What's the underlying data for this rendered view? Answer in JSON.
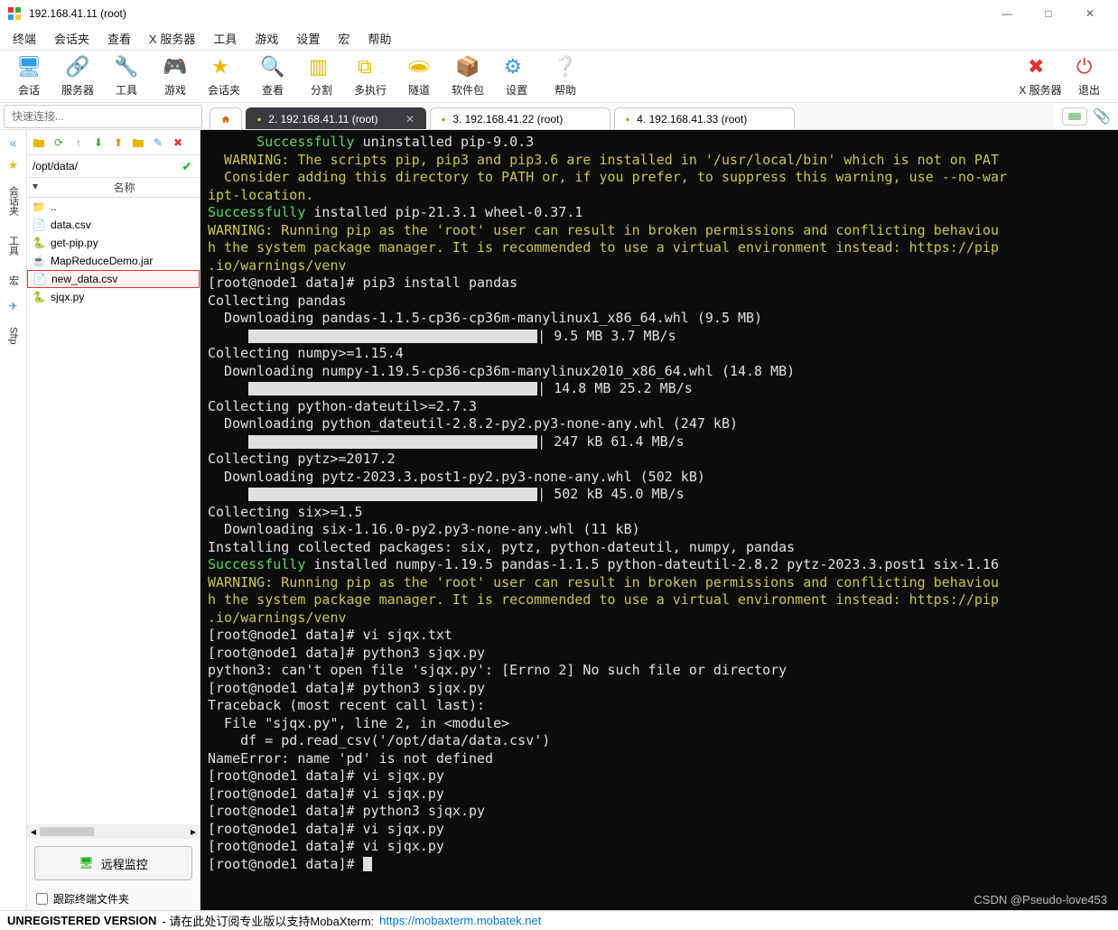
{
  "window": {
    "title": "192.168.41.11 (root)"
  },
  "menu": [
    "终端",
    "会话夹",
    "查看",
    "X 服务器",
    "工具",
    "游戏",
    "设置",
    "宏",
    "帮助"
  ],
  "toolbar": [
    {
      "label": "会话",
      "name": "session"
    },
    {
      "label": "服务器",
      "name": "server"
    },
    {
      "label": "工具",
      "name": "tools"
    },
    {
      "label": "游戏",
      "name": "games"
    },
    {
      "label": "会话夹",
      "name": "session-folder"
    },
    {
      "label": "查看",
      "name": "view"
    },
    {
      "label": "分割",
      "name": "split"
    },
    {
      "label": "多执行",
      "name": "multiexec"
    },
    {
      "label": "隧道",
      "name": "tunnel"
    },
    {
      "label": "软件包",
      "name": "packages"
    },
    {
      "label": "设置",
      "name": "settings"
    },
    {
      "label": "帮助",
      "name": "help"
    }
  ],
  "toolbar_right": [
    {
      "label": "X 服务器",
      "name": "xserver"
    },
    {
      "label": "退出",
      "name": "exit"
    }
  ],
  "quick": {
    "placeholder": "快速连接..."
  },
  "tabs": [
    {
      "label": "2. 192.168.41.11 (root)",
      "active": true
    },
    {
      "label": "3. 192.168.41.22 (root)",
      "active": false
    },
    {
      "label": "4. 192.168.41.33 (root)",
      "active": false
    }
  ],
  "sidebar_tabs": [
    "会话夹",
    "工具",
    "宏",
    "Sftp"
  ],
  "sftp": {
    "path": "/opt/data/",
    "header_name": "名称",
    "items": [
      {
        "name": "..",
        "type": "up"
      },
      {
        "name": "data.csv",
        "type": "csv"
      },
      {
        "name": "get-pip.py",
        "type": "py"
      },
      {
        "name": "MapReduceDemo.jar",
        "type": "jar"
      },
      {
        "name": "new_data.csv",
        "type": "csv",
        "selected": true
      },
      {
        "name": "sjqx.py",
        "type": "py"
      }
    ],
    "remote_monitor": "远程监控",
    "follow_checkbox": "跟踪终端文件夹"
  },
  "terminal": {
    "lines": [
      {
        "segs": [
          {
            "c": "grn",
            "t": "      Successfully"
          },
          {
            "t": " uninstalled pip-9.0.3"
          }
        ]
      },
      {
        "segs": [
          {
            "c": "yel",
            "t": "  WARNING: The scripts pip, pip3 and pip3.6 are installed in '/usr/local/bin' which is not on PAT"
          }
        ]
      },
      {
        "segs": [
          {
            "c": "yel",
            "t": "  Consider adding this directory to PATH or, if you prefer, to suppress this warning, use --no-war"
          }
        ]
      },
      {
        "segs": [
          {
            "c": "yel",
            "t": "ipt-location."
          }
        ]
      },
      {
        "segs": [
          {
            "c": "grn",
            "t": "Successfully"
          },
          {
            "t": " installed pip-21.3.1 wheel-0.37.1"
          }
        ]
      },
      {
        "segs": [
          {
            "c": "yel",
            "t": "WARNING: Running pip as the 'root' user can result in broken permissions and conflicting behaviou"
          }
        ]
      },
      {
        "segs": [
          {
            "c": "yel",
            "t": "h the system package manager. It is recommended to use a virtual environment instead: https://pip"
          }
        ]
      },
      {
        "segs": [
          {
            "c": "yel",
            "t": ".io/warnings/venv"
          }
        ]
      },
      {
        "segs": [
          {
            "t": "[root@node1 data]# pip3 install pandas"
          }
        ]
      },
      {
        "segs": [
          {
            "t": "Collecting pandas"
          }
        ]
      },
      {
        "segs": [
          {
            "t": "  Downloading pandas-1.1.5-cp36-cp36m-manylinux1_x86_64.whl (9.5 MB)"
          }
        ]
      },
      {
        "segs": [
          {
            "t": "     "
          },
          {
            "bar": true
          },
          {
            "t": "| 9.5 MB 3.7 MB/s"
          }
        ]
      },
      {
        "segs": [
          {
            "t": "Collecting numpy>=1.15.4"
          }
        ]
      },
      {
        "segs": [
          {
            "t": "  Downloading numpy-1.19.5-cp36-cp36m-manylinux2010_x86_64.whl (14.8 MB)"
          }
        ]
      },
      {
        "segs": [
          {
            "t": "     "
          },
          {
            "bar": true
          },
          {
            "t": "| 14.8 MB 25.2 MB/s"
          }
        ]
      },
      {
        "segs": [
          {
            "t": "Collecting python-dateutil>=2.7.3"
          }
        ]
      },
      {
        "segs": [
          {
            "t": "  Downloading python_dateutil-2.8.2-py2.py3-none-any.whl (247 kB)"
          }
        ]
      },
      {
        "segs": [
          {
            "t": "     "
          },
          {
            "bar": true
          },
          {
            "t": "| 247 kB 61.4 MB/s"
          }
        ]
      },
      {
        "segs": [
          {
            "t": "Collecting pytz>=2017.2"
          }
        ]
      },
      {
        "segs": [
          {
            "t": "  Downloading pytz-2023.3.post1-py2.py3-none-any.whl (502 kB)"
          }
        ]
      },
      {
        "segs": [
          {
            "t": "     "
          },
          {
            "bar": true
          },
          {
            "t": "| 502 kB 45.0 MB/s"
          }
        ]
      },
      {
        "segs": [
          {
            "t": "Collecting six>=1.5"
          }
        ]
      },
      {
        "segs": [
          {
            "t": "  Downloading six-1.16.0-py2.py3-none-any.whl (11 kB)"
          }
        ]
      },
      {
        "segs": [
          {
            "t": "Installing collected packages: six, pytz, python-dateutil, numpy, pandas"
          }
        ]
      },
      {
        "segs": [
          {
            "c": "grn",
            "t": "Successfully"
          },
          {
            "t": " installed numpy-1.19.5 pandas-1.1.5 python-dateutil-2.8.2 pytz-2023.3.post1 six-1.16"
          }
        ]
      },
      {
        "segs": [
          {
            "c": "yel",
            "t": "WARNING: Running pip as the 'root' user can result in broken permissions and conflicting behaviou"
          }
        ]
      },
      {
        "segs": [
          {
            "c": "yel",
            "t": "h the system package manager. It is recommended to use a virtual environment instead: https://pip"
          }
        ]
      },
      {
        "segs": [
          {
            "c": "yel",
            "t": ".io/warnings/venv"
          }
        ]
      },
      {
        "segs": [
          {
            "t": "[root@node1 data]# vi sjqx.txt"
          }
        ]
      },
      {
        "segs": [
          {
            "t": "[root@node1 data]# python3 sjqx.py"
          }
        ]
      },
      {
        "segs": [
          {
            "t": "python3: can't open file 'sjqx.py': [Errno 2] No such file or directory"
          }
        ]
      },
      {
        "segs": [
          {
            "t": "[root@node1 data]# python3 sjqx.py"
          }
        ]
      },
      {
        "segs": [
          {
            "t": "Traceback (most recent call last):"
          }
        ]
      },
      {
        "segs": [
          {
            "t": "  File \"sjqx.py\", line 2, in <module>"
          }
        ]
      },
      {
        "segs": [
          {
            "t": "    df = pd.read_csv('/opt/data/data.csv')"
          }
        ]
      },
      {
        "segs": [
          {
            "t": "NameError: name 'pd' is not defined"
          }
        ]
      },
      {
        "segs": [
          {
            "t": "[root@node1 data]# vi sjqx.py"
          }
        ]
      },
      {
        "segs": [
          {
            "t": "[root@node1 data]# vi sjqx.py"
          }
        ]
      },
      {
        "segs": [
          {
            "t": "[root@node1 data]# python3 sjqx.py"
          }
        ]
      },
      {
        "segs": [
          {
            "t": "[root@node1 data]# vi sjqx.py"
          }
        ]
      },
      {
        "segs": [
          {
            "t": "[root@node1 data]# vi sjqx.py"
          }
        ]
      },
      {
        "segs": [
          {
            "t": "[root@node1 data]# "
          },
          {
            "cursor": true
          }
        ]
      }
    ]
  },
  "status": {
    "unreg": "UNREGISTERED VERSION",
    "mid": "- 请在此处订阅专业版以支持MobaXterm:",
    "link": "https://mobaxterm.mobatek.net"
  },
  "watermark": "CSDN @Pseudo-love453"
}
